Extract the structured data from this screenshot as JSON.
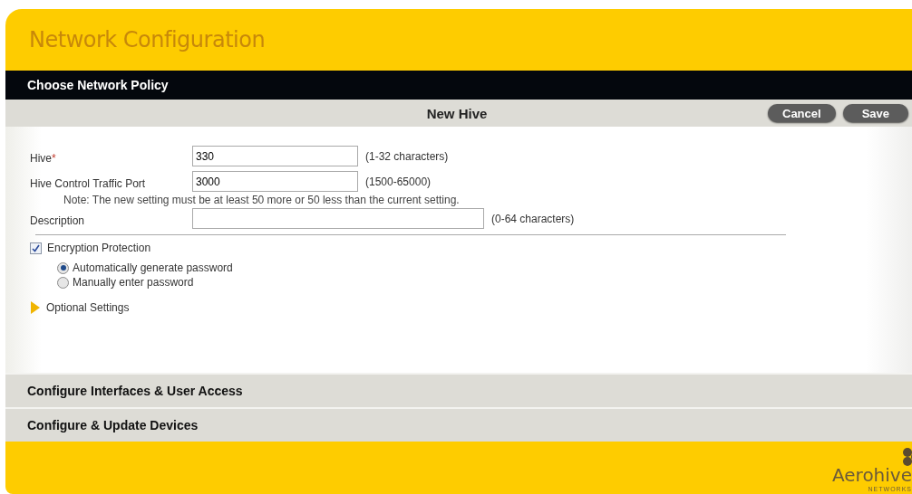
{
  "header": {
    "title": "Network Configuration"
  },
  "active_step": {
    "title": "Choose Network Policy"
  },
  "form_bar": {
    "title": "New Hive",
    "buttons": [
      {
        "label": "Cancel"
      },
      {
        "label": "Save"
      }
    ]
  },
  "fields": [
    {
      "label": "Hive",
      "required_mark": "*",
      "value": "330",
      "hint": "(1-32 characters)",
      "kind": "short"
    },
    {
      "label": "Hive Control Traffic Port",
      "value": "3000",
      "hint": "(1500-65000)",
      "kind": "short",
      "note": "Note: The new setting must be at least 50 more or 50 less than the current setting."
    },
    {
      "label": "Description",
      "hint": "(0-64 characters)",
      "kind": "long"
    }
  ],
  "encryption": {
    "label": "Encryption Protection",
    "checked": true,
    "options": [
      {
        "label": "Automatically generate password",
        "selected": true
      },
      {
        "label": "Manually enter password",
        "selected": false
      }
    ]
  },
  "optional_settings": {
    "label": "Optional Settings",
    "expanded": false
  },
  "steps": [
    {
      "title": "Configure Interfaces & User Access"
    },
    {
      "title": "Configure & Update Devices"
    }
  ],
  "footer": {
    "logo": "Aerohive",
    "logo_sub": "NETWORKS"
  }
}
